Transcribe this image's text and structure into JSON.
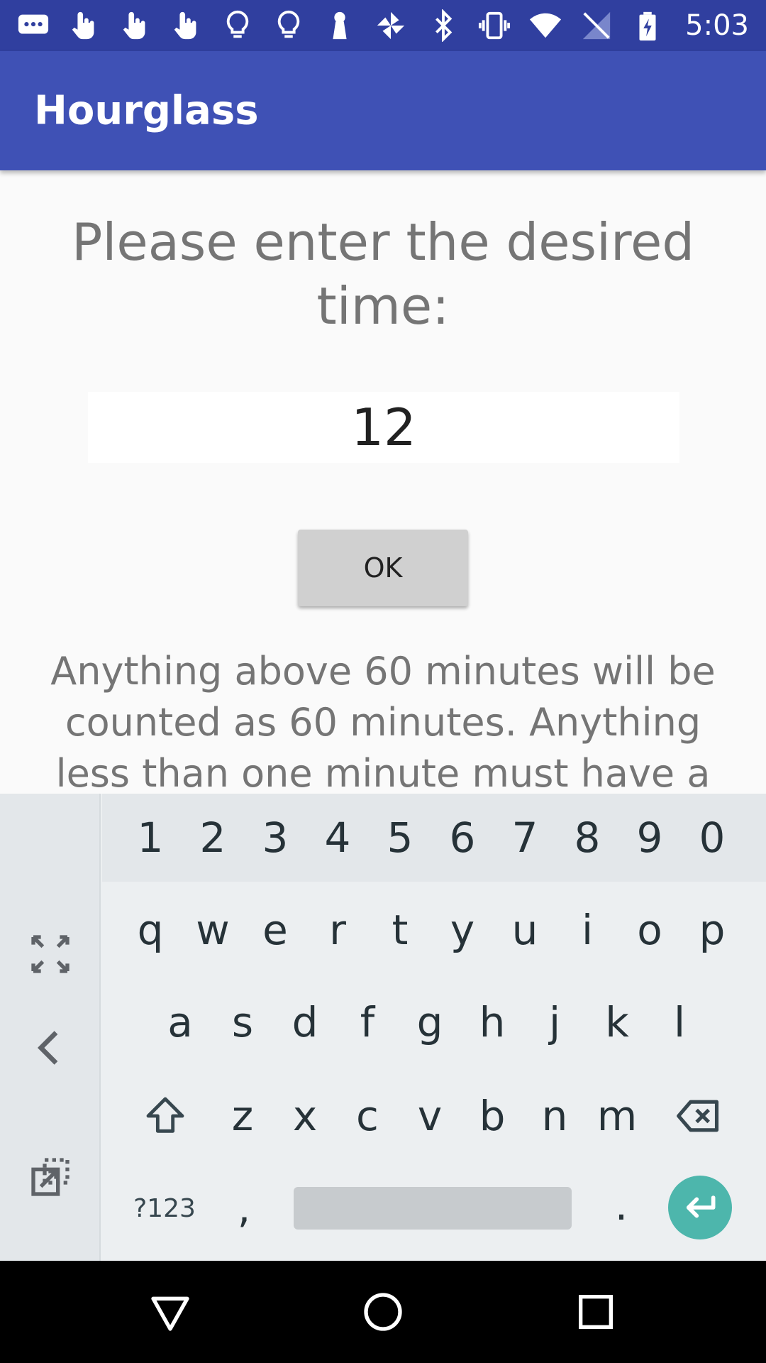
{
  "status_bar": {
    "time": "5:03",
    "left_icons": [
      "message-icon",
      "touch-icon",
      "touch-icon",
      "touch-icon",
      "lightbulb-icon",
      "lightbulb-icon",
      "keyhole-icon",
      "pinwheel-icon"
    ],
    "right_icons": [
      "bluetooth-icon",
      "vibrate-icon",
      "wifi-icon",
      "no-signal-icon",
      "battery-charging-icon"
    ]
  },
  "app_bar": {
    "title": "Hourglass"
  },
  "main": {
    "prompt": "Please enter the desired time:",
    "time_input_value": "12",
    "ok_label": "OK",
    "note": "Anything above 60 minutes will be counted as 60 minutes. Anything less than one minute must have a"
  },
  "keyboard": {
    "number_row": [
      "1",
      "2",
      "3",
      "4",
      "5",
      "6",
      "7",
      "8",
      "9",
      "0"
    ],
    "row1": [
      "q",
      "w",
      "e",
      "r",
      "t",
      "y",
      "u",
      "i",
      "o",
      "p"
    ],
    "row2": [
      "a",
      "s",
      "d",
      "f",
      "g",
      "h",
      "j",
      "k",
      "l"
    ],
    "row3": [
      "z",
      "x",
      "c",
      "v",
      "b",
      "n",
      "m"
    ],
    "symbols_label": "?123",
    "comma_label": ",",
    "period_label": "."
  },
  "colors": {
    "status_bar": "#303f9f",
    "app_bar": "#3f51b5",
    "enter_key": "#4db6ac"
  }
}
